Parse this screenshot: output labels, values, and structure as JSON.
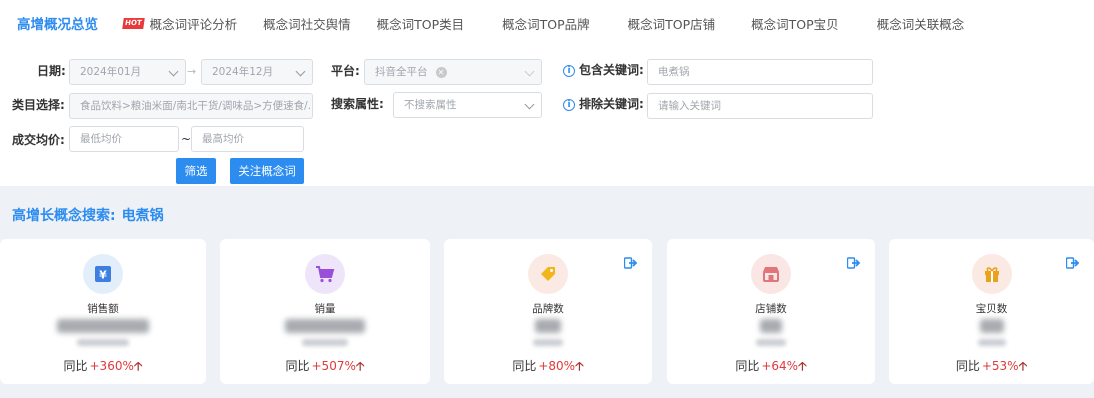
{
  "tabs": [
    {
      "label": "高增概况总览",
      "active": true
    },
    {
      "label": "概念词评论分析",
      "badge": "HOT"
    },
    {
      "label": "概念词社交舆情"
    },
    {
      "label": "概念词TOP类目"
    },
    {
      "label": "概念词TOP品牌"
    },
    {
      "label": "概念词TOP店铺"
    },
    {
      "label": "概念词TOP宝贝"
    },
    {
      "label": "概念词关联概念"
    }
  ],
  "filters": {
    "date_label": "日期:",
    "date_start": "2024年01月",
    "date_end": "2024年12月",
    "platform_label": "平台:",
    "platform_value": "抖音全平台",
    "include_label": "包含关键词:",
    "include_value": "电煮锅",
    "category_label": "类目选择:",
    "category_value": "食品饮料>粮油米面/南北干货/调味品>方便速食/...",
    "search_attr_label": "搜索属性:",
    "search_attr_value": "不搜索属性",
    "exclude_label": "排除关键词:",
    "exclude_placeholder": "请输入关键词",
    "price_label": "成交均价:",
    "price_min_placeholder": "最低均价",
    "price_max_placeholder": "最高均价",
    "tilde": "~",
    "filter_button": "筛选",
    "follow_button": "关注概念词"
  },
  "section": {
    "title": "高增长概念搜索:",
    "keyword": "电煮锅"
  },
  "cards": [
    {
      "label": "销售额",
      "icon": "yuan-icon",
      "yoy_label": "同比",
      "yoy": "+360%",
      "color": "#3d7fe0",
      "bg": "#e3eefb"
    },
    {
      "label": "销量",
      "icon": "cart-icon",
      "yoy_label": "同比",
      "yoy": "+507%",
      "color": "#9a4fd8",
      "bg": "#efe5fa"
    },
    {
      "label": "品牌数",
      "icon": "tag-icon",
      "yoy_label": "同比",
      "yoy": "+80%",
      "color": "#f2b51a",
      "bg": "#fbe9e4"
    },
    {
      "label": "店铺数",
      "icon": "shop-icon",
      "yoy_label": "同比",
      "yoy": "+64%",
      "color": "#e0757a",
      "bg": "#fbe6e6"
    },
    {
      "label": "宝贝数",
      "icon": "gift-icon",
      "yoy_label": "同比",
      "yoy": "+53%",
      "color": "#e9a21c",
      "bg": "#fbe9e4"
    }
  ],
  "colors": {
    "accent": "#2d8cf0",
    "up": "#e2383a"
  }
}
